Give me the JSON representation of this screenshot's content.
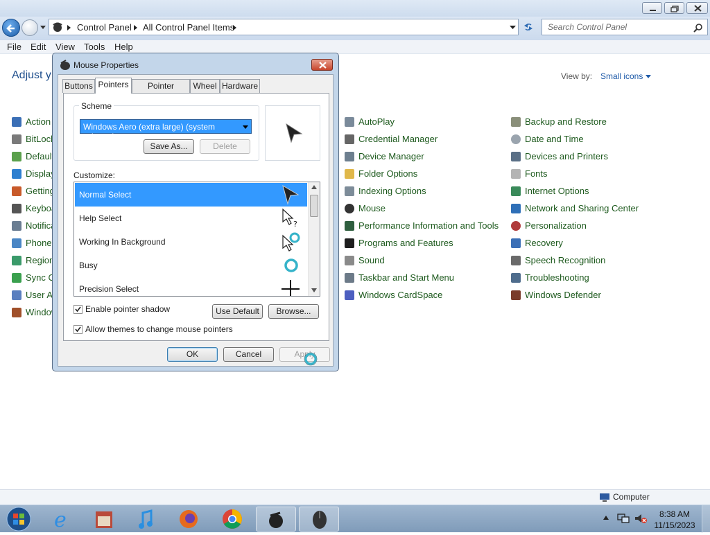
{
  "window": {
    "breadcrumb": [
      "Control Panel",
      "All Control Panel Items"
    ],
    "search_placeholder": "Search Control Panel"
  },
  "menubar": [
    "File",
    "Edit",
    "View",
    "Tools",
    "Help"
  ],
  "content": {
    "title": "Adjust y",
    "view_by_label": "View by:",
    "view_by_value": "Small icons"
  },
  "cp_items_col1": [
    "Action",
    "BitLock",
    "Default",
    "Display",
    "Getting",
    "Keyboa",
    "Notifica",
    "Phone",
    "Region",
    "Sync C",
    "User Ac",
    "Window"
  ],
  "cp_items_col2": [
    "AutoPlay",
    "Credential Manager",
    "Device Manager",
    "Folder Options",
    "Indexing Options",
    "Mouse",
    "Performance Information and Tools",
    "Programs and Features",
    "Sound",
    "Taskbar and Start Menu",
    "Windows CardSpace"
  ],
  "cp_items_col3": [
    "Backup and Restore",
    "Date and Time",
    "Devices and Printers",
    "Fonts",
    "Internet Options",
    "Network and Sharing Center",
    "Personalization",
    "Recovery",
    "Speech Recognition",
    "Troubleshooting",
    "Windows Defender"
  ],
  "statusbar": {
    "computer": "Computer"
  },
  "taskbar": {
    "time": "8:38 AM",
    "date": "11/15/2023"
  },
  "dialog": {
    "title": "Mouse Properties",
    "tabs": [
      "Buttons",
      "Pointers",
      "Pointer Options",
      "Wheel",
      "Hardware"
    ],
    "scheme_label": "Scheme",
    "scheme_value": "Windows Aero (extra large) (system scheme)",
    "save_as": "Save As...",
    "delete": "Delete",
    "customize_label": "Customize:",
    "cursors": [
      "Normal Select",
      "Help Select",
      "Working In Background",
      "Busy",
      "Precision Select"
    ],
    "enable_shadow": "Enable pointer shadow",
    "allow_themes": "Allow themes to change mouse pointers",
    "use_default": "Use Default",
    "browse": "Browse...",
    "ok": "OK",
    "cancel": "Cancel",
    "apply": "Apply"
  }
}
